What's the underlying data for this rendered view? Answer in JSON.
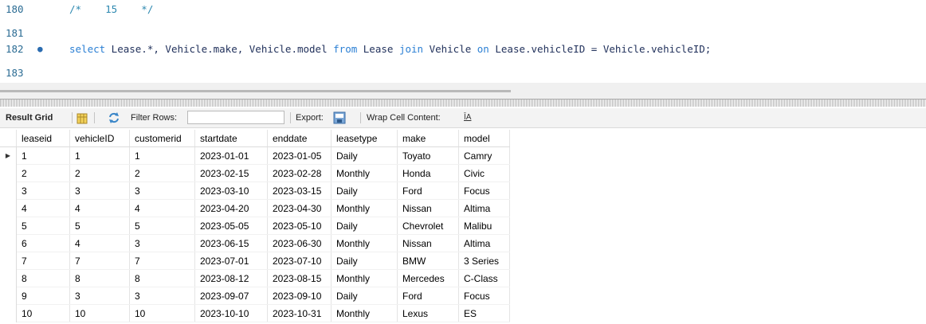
{
  "editor": {
    "lines": [
      {
        "number": "180",
        "marker": "",
        "segments": [
          {
            "t": "/*    15    */",
            "cls": "cmt"
          }
        ]
      },
      {
        "number": "181",
        "marker": "",
        "segments": []
      },
      {
        "number": "182",
        "marker": "●",
        "segments": [
          {
            "t": "select",
            "cls": "kw"
          },
          {
            "t": " Lease.*, Vehicle.make, Vehicle.model ",
            "cls": ""
          },
          {
            "t": "from",
            "cls": "kw"
          },
          {
            "t": " Lease ",
            "cls": ""
          },
          {
            "t": "join",
            "cls": "kw"
          },
          {
            "t": " Vehicle ",
            "cls": ""
          },
          {
            "t": "on",
            "cls": "kw"
          },
          {
            "t": " Lease.vehicleID = Vehicle.vehicleID;",
            "cls": ""
          }
        ]
      },
      {
        "number": "183",
        "marker": "",
        "segments": []
      }
    ]
  },
  "toolbar": {
    "result_grid": "Result Grid",
    "filter_rows": "Filter Rows:",
    "filter_value": "",
    "export": "Export:",
    "wrap": "Wrap Cell Content:",
    "wrap_icon": "ĪA"
  },
  "grid": {
    "columns": [
      "leaseid",
      "vehicleID",
      "customerid",
      "startdate",
      "enddate",
      "leasetype",
      "make",
      "model"
    ],
    "rows": [
      [
        "1",
        "1",
        "1",
        "2023-01-01",
        "2023-01-05",
        "Daily",
        "Toyato",
        "Camry"
      ],
      [
        "2",
        "2",
        "2",
        "2023-02-15",
        "2023-02-28",
        "Monthly",
        "Honda",
        "Civic"
      ],
      [
        "3",
        "3",
        "3",
        "2023-03-10",
        "2023-03-15",
        "Daily",
        "Ford",
        "Focus"
      ],
      [
        "4",
        "4",
        "4",
        "2023-04-20",
        "2023-04-30",
        "Monthly",
        "Nissan",
        "Altima"
      ],
      [
        "5",
        "5",
        "5",
        "2023-05-05",
        "2023-05-10",
        "Daily",
        "Chevrolet",
        "Malibu"
      ],
      [
        "6",
        "4",
        "3",
        "2023-06-15",
        "2023-06-30",
        "Monthly",
        "Nissan",
        "Altima"
      ],
      [
        "7",
        "7",
        "7",
        "2023-07-01",
        "2023-07-10",
        "Daily",
        "BMW",
        "3 Series"
      ],
      [
        "8",
        "8",
        "8",
        "2023-08-12",
        "2023-08-15",
        "Monthly",
        "Mercedes",
        "C-Class"
      ],
      [
        "9",
        "3",
        "3",
        "2023-09-07",
        "2023-09-10",
        "Daily",
        "Ford",
        "Focus"
      ],
      [
        "10",
        "10",
        "10",
        "2023-10-10",
        "2023-10-31",
        "Monthly",
        "Lexus",
        "ES"
      ]
    ],
    "current_row_marker": "▶"
  }
}
